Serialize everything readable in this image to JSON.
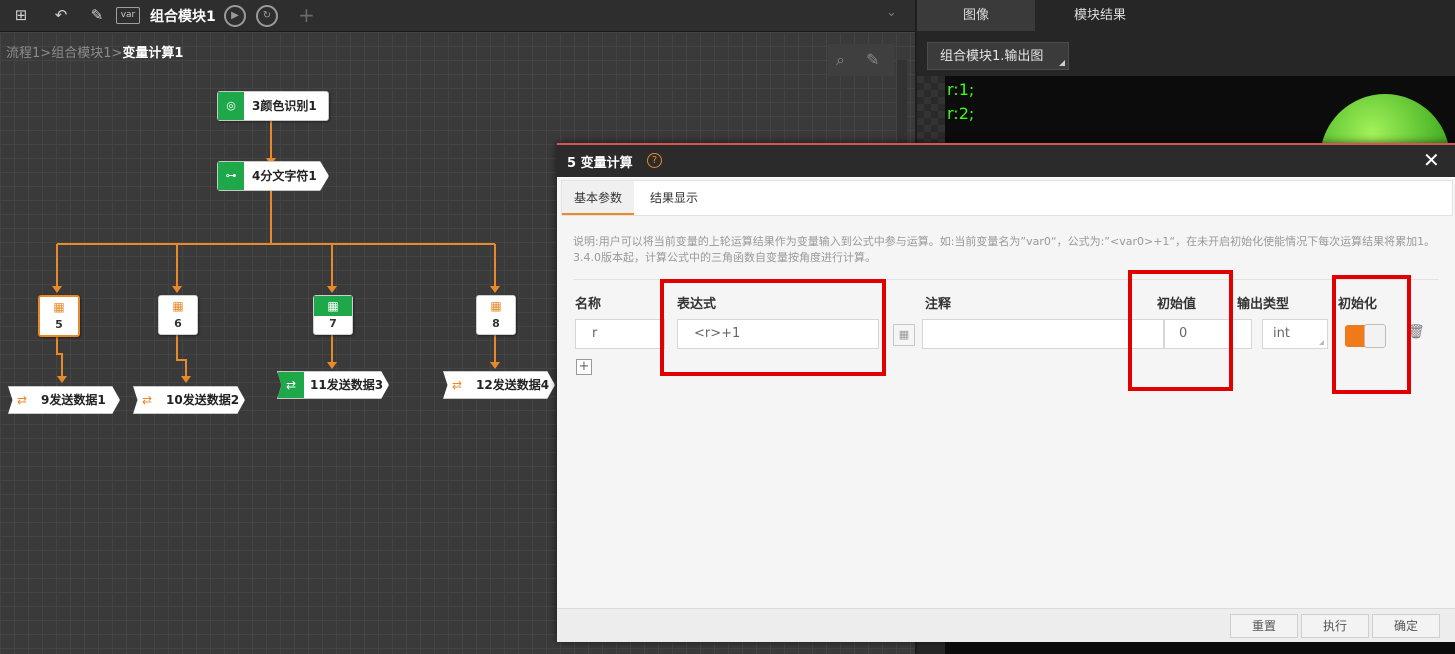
{
  "toolbar": {
    "tab_title": "组合模块1",
    "var_label": "var"
  },
  "breadcrumb": {
    "part1": "流程1",
    "sep": ">",
    "part2": "组合模块1",
    "current": "变量计算1"
  },
  "flow": {
    "color_node": "3颜色识别1",
    "split_node": "4分文字符1",
    "calc_nodes": [
      "5",
      "6",
      "7",
      "8"
    ],
    "send_nodes": [
      "9发送数据1",
      "10发送数据2",
      "11发送数据3",
      "12发送数据4"
    ]
  },
  "right_panel": {
    "tabs": [
      "图像",
      "模块结果"
    ],
    "image_source": "组合模块1.输出图",
    "overlay_lines": [
      "r:1;",
      "r:2;"
    ]
  },
  "dialog": {
    "title": "5 变量计算",
    "tabs": [
      "基本参数",
      "结果显示"
    ],
    "description": "说明:用户可以将当前变量的上轮运算结果作为变量输入到公式中参与运算。如:当前变量名为”var0“，公式为:”<var0>+1“，在未开启初始化使能情况下每次运算结果将累加1。3.4.0版本起，计算公式中的三角函数自变量按角度进行计算。",
    "columns": {
      "name": "名称",
      "expression": "表达式",
      "comment": "注释",
      "initial": "初始值",
      "output_type": "输出类型",
      "init": "初始化"
    },
    "row": {
      "name": "r",
      "expression": "<r>+1",
      "comment": "",
      "initial": "0",
      "output_type": "int",
      "init_enabled": true
    },
    "buttons": {
      "reset": "重置",
      "execute": "执行",
      "confirm": "确定"
    }
  },
  "colors": {
    "accent": "#e8892a",
    "ok_green": "#1fa84a",
    "highlight_red": "#e00000"
  }
}
